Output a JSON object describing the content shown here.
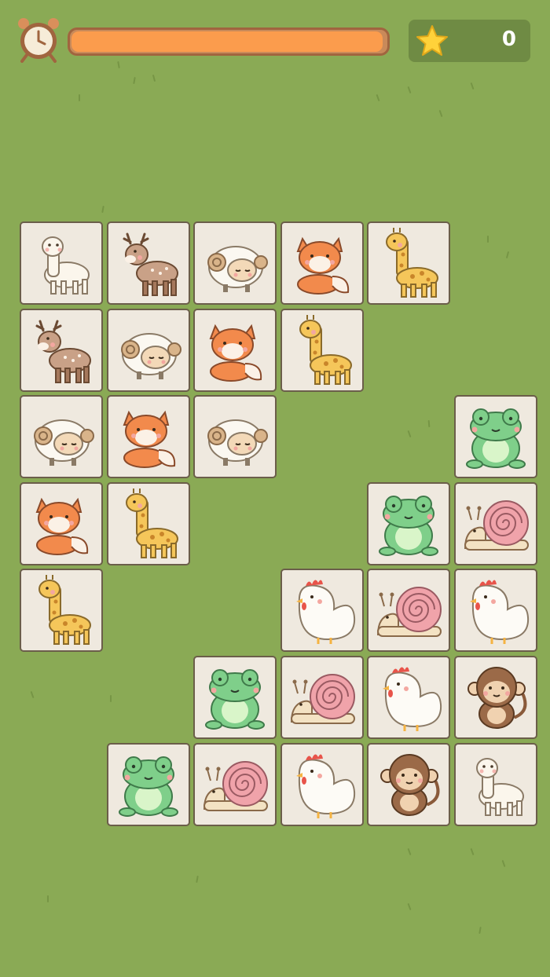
{
  "hud": {
    "timer_fraction": 0.99,
    "score": "0",
    "clock_icon": "alarm-clock-icon",
    "star_icon": "star-icon"
  },
  "colors": {
    "background": "#8aaa55",
    "tile": "#efe9df",
    "timer_fill": "#fb9c4d",
    "score_panel": "#6f8b44"
  },
  "board": {
    "columns": 6,
    "rows": 7,
    "tiles": [
      {
        "row": 0,
        "col": 0,
        "animal": "alpaca"
      },
      {
        "row": 0,
        "col": 1,
        "animal": "deer"
      },
      {
        "row": 0,
        "col": 2,
        "animal": "sheep"
      },
      {
        "row": 0,
        "col": 3,
        "animal": "fox"
      },
      {
        "row": 0,
        "col": 4,
        "animal": "giraffe"
      },
      {
        "row": 1,
        "col": 0,
        "animal": "deer"
      },
      {
        "row": 1,
        "col": 1,
        "animal": "sheep"
      },
      {
        "row": 1,
        "col": 2,
        "animal": "fox"
      },
      {
        "row": 1,
        "col": 3,
        "animal": "giraffe"
      },
      {
        "row": 2,
        "col": 0,
        "animal": "sheep"
      },
      {
        "row": 2,
        "col": 1,
        "animal": "fox"
      },
      {
        "row": 2,
        "col": 2,
        "animal": "sheep"
      },
      {
        "row": 2,
        "col": 5,
        "animal": "frog"
      },
      {
        "row": 3,
        "col": 0,
        "animal": "fox"
      },
      {
        "row": 3,
        "col": 1,
        "animal": "giraffe"
      },
      {
        "row": 3,
        "col": 4,
        "animal": "frog"
      },
      {
        "row": 3,
        "col": 5,
        "animal": "snail"
      },
      {
        "row": 4,
        "col": 0,
        "animal": "giraffe"
      },
      {
        "row": 4,
        "col": 3,
        "animal": "chicken"
      },
      {
        "row": 4,
        "col": 4,
        "animal": "snail"
      },
      {
        "row": 4,
        "col": 5,
        "animal": "chicken"
      },
      {
        "row": 5,
        "col": 2,
        "animal": "frog"
      },
      {
        "row": 5,
        "col": 3,
        "animal": "snail"
      },
      {
        "row": 5,
        "col": 4,
        "animal": "chicken"
      },
      {
        "row": 5,
        "col": 5,
        "animal": "monkey"
      },
      {
        "row": 6,
        "col": 1,
        "animal": "frog"
      },
      {
        "row": 6,
        "col": 2,
        "animal": "snail"
      },
      {
        "row": 6,
        "col": 3,
        "animal": "chicken"
      },
      {
        "row": 6,
        "col": 4,
        "animal": "monkey"
      },
      {
        "row": 6,
        "col": 5,
        "animal": "alpaca"
      }
    ]
  }
}
